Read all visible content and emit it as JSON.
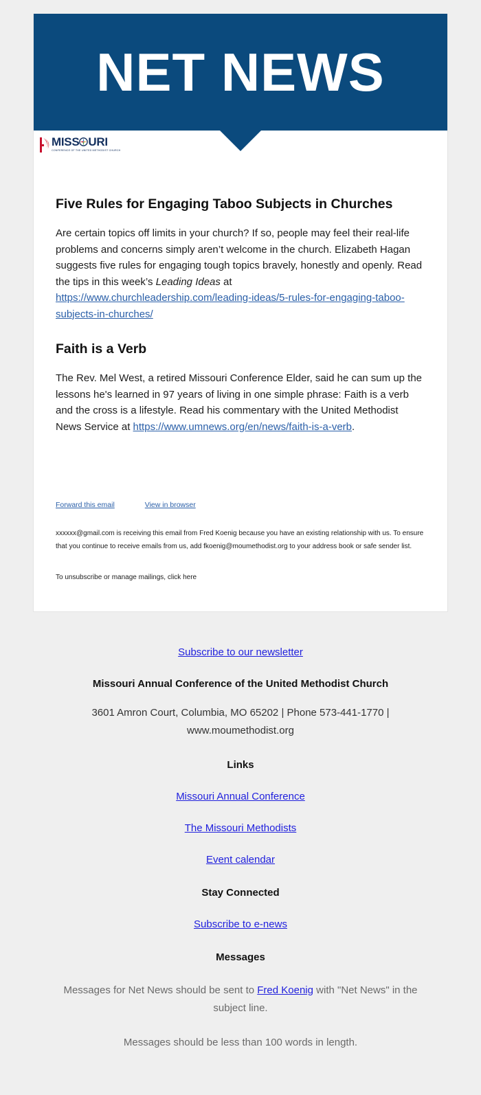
{
  "banner": {
    "title": "NET NEWS",
    "background_color": "#0b4a7d",
    "text_color": "#ffffff"
  },
  "logo": {
    "word": "MISS",
    "word_tail": "URI",
    "subtitle": "CONFERENCE OF THE UNITED METHODIST CHURCH",
    "mark_name": "cross-and-flame-icon",
    "color": "#14305e"
  },
  "articles": [
    {
      "title": "Five Rules for Engaging Taboo Subjects in Churches",
      "body_part1": "Are certain topics off limits in your church? If so, people may feel their real-life problems and concerns simply aren’t welcome in the church. Elizabeth Hagan suggests five rules for engaging tough topics bravely, honestly and openly. Read the tips in this week’s ",
      "body_italic": "Leading Ideas",
      "body_part2": " at ",
      "link_text": "https://www.churchleadership.com/leading-ideas/5-rules-for-engaging-taboo-subjects-in-churches/",
      "body_part3": ""
    },
    {
      "title": "Faith is a Verb",
      "body_part1": "The Rev. Mel West, a retired Missouri Conference Elder, said he can sum up the lessons he's learned in 97 years of living in one simple phrase: Faith is a verb and the cross is a lifestyle. Read his commentary with the United Methodist News Service at ",
      "link_text": "https://www.umnews.org/en/news/faith-is-a-verb",
      "body_part3": "."
    }
  ],
  "mini_links": [
    {
      "label": "Forward this email"
    },
    {
      "label": "View in browser"
    }
  ],
  "disclaimer": {
    "line1": "xxxxxx@gmail.com is receiving this email from Fred Koenig because you have an existing relationship with us. To ensure that you continue to receive emails from us, add fkoenig@moumethodist.org to your address book or safe sender list.",
    "unsubscribe": "To unsubscribe or manage mailings, click here"
  },
  "footer": {
    "subscribe_newsletter": "Subscribe to our newsletter",
    "org_name": "Missouri Annual Conference of the United Methodist Church",
    "address": "3601 Amron Court, Columbia, MO 65202 | Phone 573-441-1770 | www.moumethodist.org",
    "links_heading": "Links",
    "links": [
      {
        "label": "Missouri Annual Conference"
      },
      {
        "label": "The Missouri Methodists"
      },
      {
        "label": "Event calendar"
      }
    ],
    "stay_connected_heading": "Stay Connected",
    "subscribe_enews": "Subscribe to e-news",
    "messages_heading": "Messages",
    "messages_note_part1": "Messages for Net News should be sent to ",
    "messages_note_link": "Fred Koenig",
    "messages_note_part2": " with \"Net News\" in the subject line.",
    "messages_length_note": "Messages should be less than 100 words in length.",
    "link_color": "#1f1fdd"
  }
}
